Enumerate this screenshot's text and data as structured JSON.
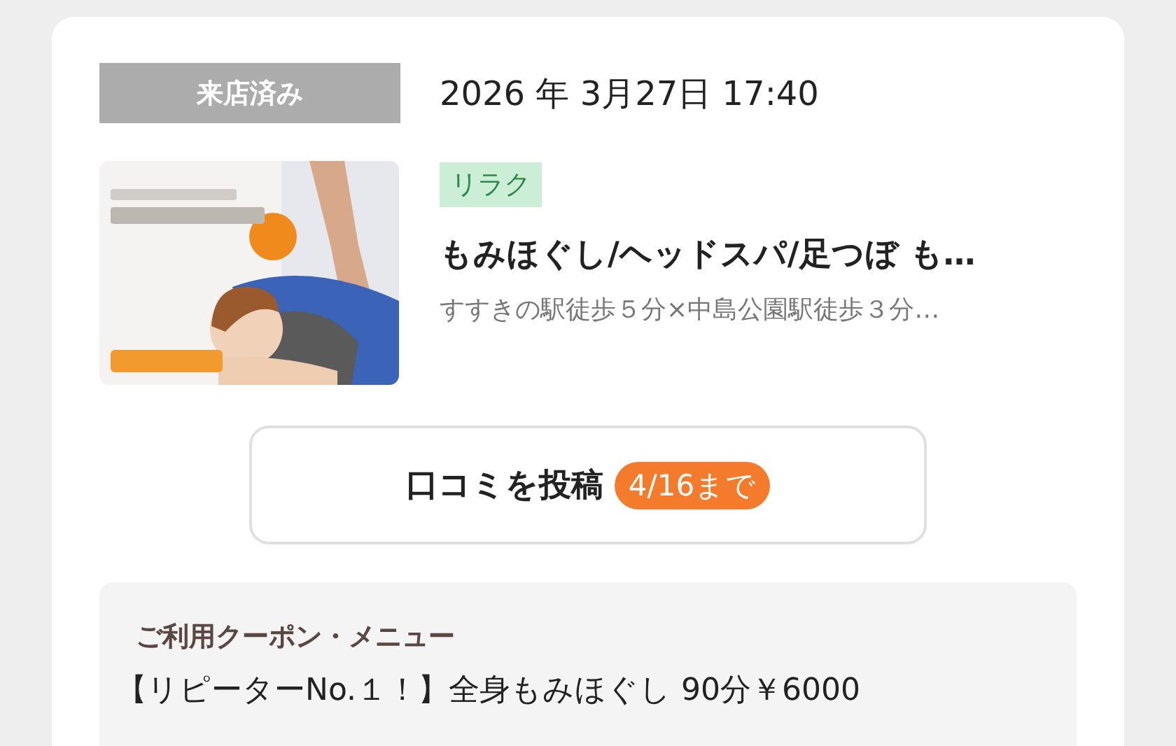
{
  "visit": {
    "status": "来店済み",
    "datetime": "2026 年 3月27日 17:40"
  },
  "salon": {
    "genre": "リラク",
    "name": "もみほぐし/ヘッドスパ/足つぼ も…",
    "access": "すすきの駅徒歩５分×中島公園駅徒歩３分…"
  },
  "review_button": {
    "label": "口コミを投稿",
    "deadline": "4/16まで"
  },
  "coupon": {
    "heading": "ご利用クーポン・メニュー",
    "text": "【リピーターNo.１！】全身もみほぐし 90分￥6000"
  }
}
